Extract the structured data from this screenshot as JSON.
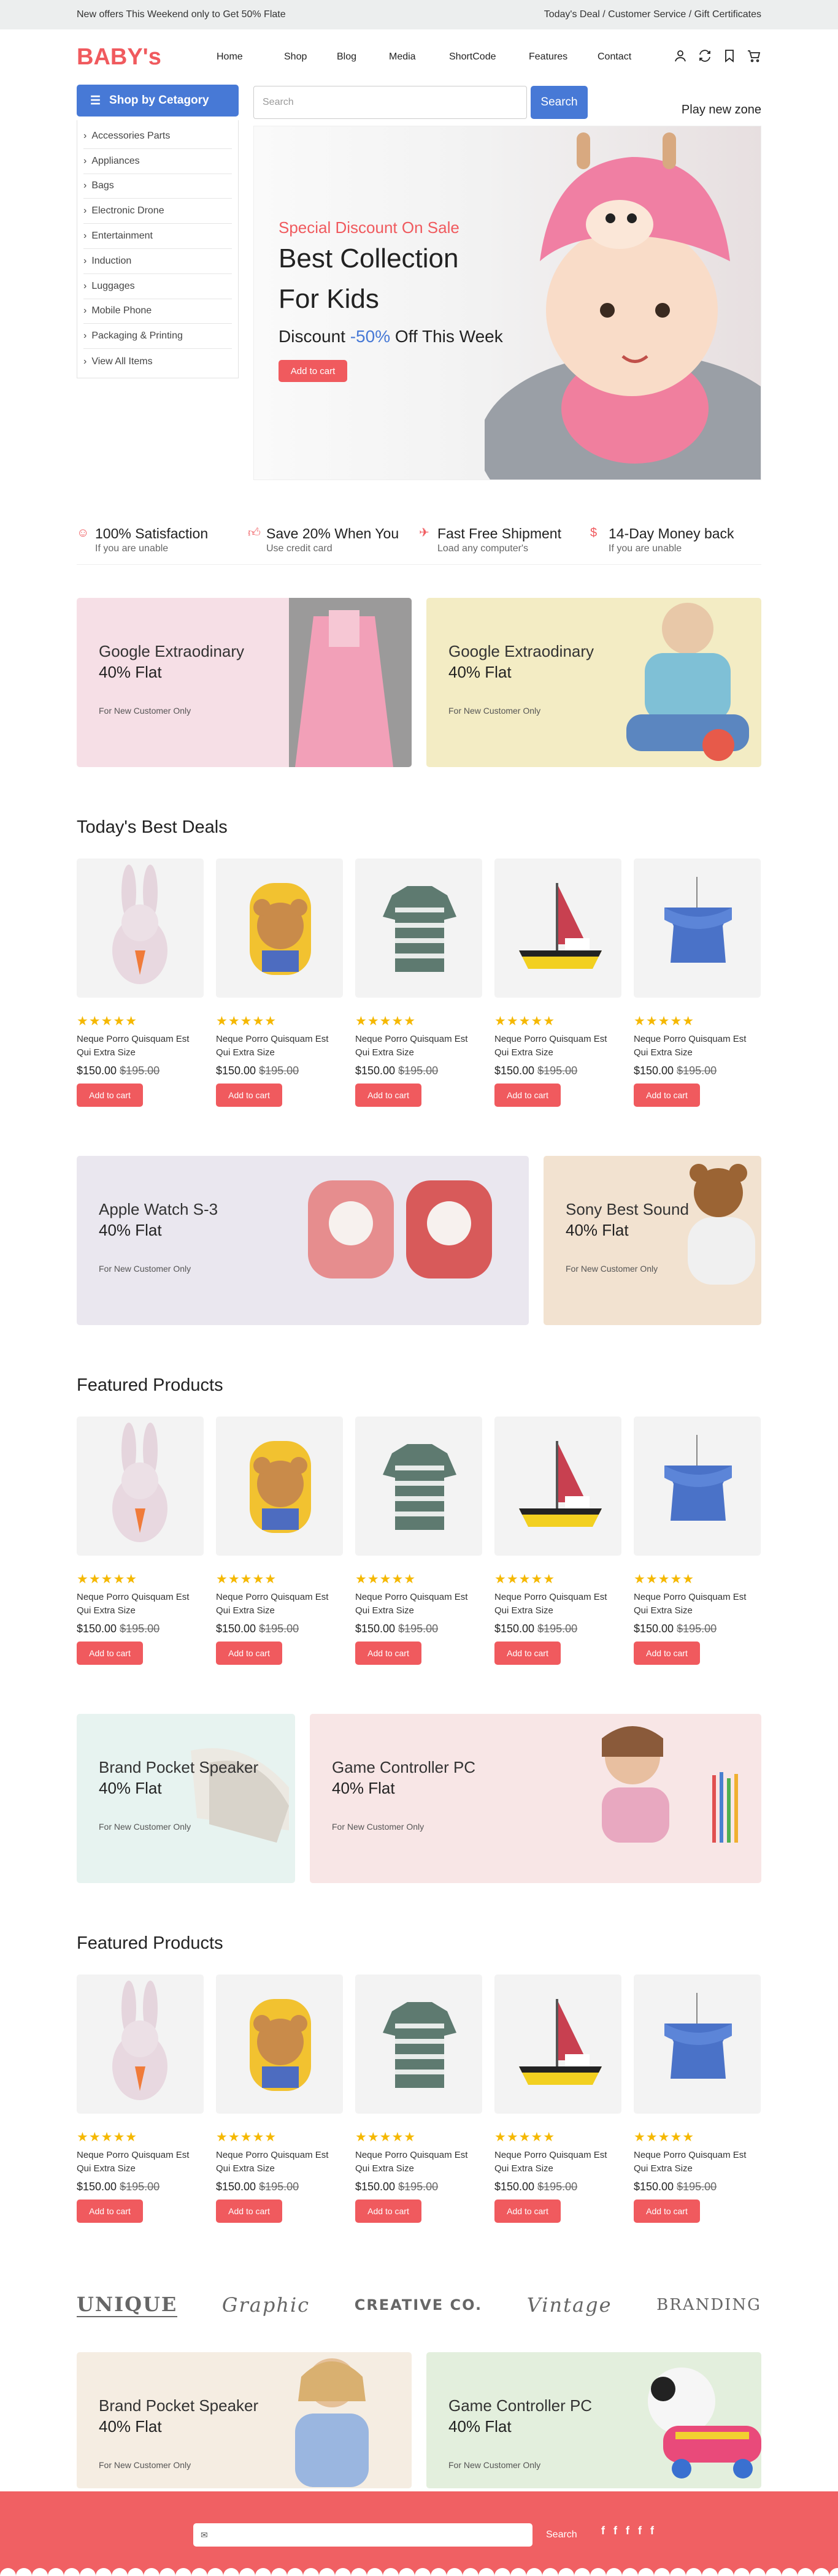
{
  "topbar": {
    "left": "New offers This Weekend only to Get 50% Flate",
    "right": "Today's Deal / Customer Service / Gift Certificates"
  },
  "brand": {
    "logo": "BABY's",
    "accent": "#f05a5e",
    "blue": "#4779d6"
  },
  "nav": [
    "Home",
    "Shop",
    "Blog",
    "Media",
    "ShortCode",
    "Features",
    "Contact"
  ],
  "header_icons": [
    "user-icon",
    "refresh-icon",
    "bookmark-icon",
    "cart-icon"
  ],
  "categories": {
    "button_label": "Shop by Cetagory",
    "items": [
      "Accessories Parts",
      "Appliances",
      "Bags",
      "Electronic Drone",
      "Entertainment",
      "Induction",
      "Luggages",
      "Mobile Phone",
      "Packaging & Printing",
      "View All Items"
    ]
  },
  "search": {
    "placeholder": "Search",
    "button": "Search"
  },
  "play_zone": "Play new zone",
  "hero": {
    "sub": "Special Discount On Sale",
    "line1": "Best Collection",
    "line2": "For Kids",
    "disc_prefix": "Discount ",
    "disc_pct": "-50%",
    "disc_suffix": " Off This Week",
    "cta": "Add to cart"
  },
  "features": [
    {
      "icon": "smile-icon",
      "title": "100% Satisfaction",
      "sub": "If you are unable"
    },
    {
      "icon": "thumbs-up-icon",
      "title": "Save 20% When You",
      "sub": "Use credit card"
    },
    {
      "icon": "shipping-icon",
      "title": "Fast Free Shipment",
      "sub": "Load any computer's"
    },
    {
      "icon": "money-icon",
      "title": "14-Day Money back",
      "sub": "If you are unable"
    }
  ],
  "promos1": [
    {
      "title": "Google Extraodinary",
      "value": "40% Flat",
      "note": "For New Customer Only",
      "bg": "#f6dfe6"
    },
    {
      "title": "Google Extraodinary",
      "value": "40% Flat",
      "note": "For New Customer Only",
      "bg": "#f3ecc4"
    }
  ],
  "promos2": [
    {
      "title": "Apple Watch S-3",
      "value": "40% Flat",
      "note": "For New Customer Only",
      "bg": "#eae7ef"
    },
    {
      "title": "Sony Best Sound",
      "value": "40% Flat",
      "note": "For New Customer Only",
      "bg": "#f2e2d0"
    }
  ],
  "promos3": [
    {
      "title": "Brand Pocket Speaker",
      "value": "40% Flat",
      "note": "For New Customer Only",
      "bg": "#e7f3f0"
    },
    {
      "title": "Game Controller PC",
      "value": "40% Flat",
      "note": "For New Customer Only",
      "bg": "#f8e6e6"
    }
  ],
  "promos4": [
    {
      "title": "Brand Pocket Speaker",
      "value": "40% Flat",
      "note": "For New Customer Only",
      "bg": "#f5ede2"
    },
    {
      "title": "Game Controller PC",
      "value": "40% Flat",
      "note": "For New Customer Only",
      "bg": "#e3efdd"
    }
  ],
  "sections": [
    "Today's Best Deals",
    "Featured Products",
    "Featured Products"
  ],
  "product": {
    "name": "Neque Porro Quisquam Est Qui Extra Size",
    "price": "$150.00",
    "old_price": "$195.00",
    "cta": "Add to cart",
    "stars": "★★★★★"
  },
  "products": [
    "bunny-toy",
    "bear-backpack",
    "striped-tshirt",
    "toy-sailboat",
    "blue-top"
  ],
  "logos": [
    "UNIQUE",
    "Graphic",
    "CREATIVE CO.",
    "Vintage",
    "BRANDING"
  ],
  "footer": {
    "placeholder": "",
    "search": "Search",
    "social": [
      "f",
      "f",
      "f",
      "f",
      "f"
    ]
  }
}
